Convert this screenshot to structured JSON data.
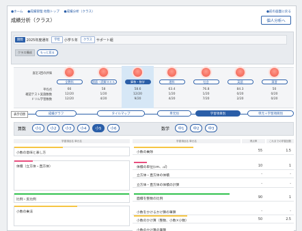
{
  "breadcrumb": [
    "●ホーム",
    "●成績管理 他塾トップ",
    "●成績分析（クラス）"
  ],
  "top_link": "●前の画面に戻る",
  "page_title": "成績分析（クラス）",
  "personal_button": "個人分析へ",
  "filters": {
    "period_tag": "期間",
    "period_value": "2025年度通年",
    "grade_tag": "学年",
    "grade_value": "小学５年",
    "class_tag": "クラス",
    "class_value": "サポート組",
    "class_members_chip": "クラス構成",
    "more_chip": "もっと見る"
  },
  "row_labels": {
    "eval": "直近3回の評価",
    "avg": "平均点",
    "test_count": "確認テスト実施数数",
    "drill_count": "ドリル学習数数"
  },
  "subjects": [
    {
      "name": "全教科",
      "avg": "66",
      "test": "12/20",
      "drill": "12/20"
    },
    {
      "name": "国語・読解スキル",
      "avg": "58",
      "test": "1/20",
      "drill": "4/20"
    },
    {
      "name": "算数・数学",
      "avg": "58.6",
      "test": "12/20",
      "drill": "9/20",
      "selected": true
    },
    {
      "name": "理科",
      "avg": "63.4",
      "test": "1/20",
      "drill": "4/20"
    },
    {
      "name": "社会",
      "avg": "76.8",
      "test": "1/20",
      "drill": "7/20"
    },
    {
      "name": "英語",
      "avg": "84.3",
      "test": "0/20",
      "drill": "2/20"
    },
    {
      "name": "演習",
      "avg": "50",
      "test": "0/20",
      "drill": "0/20"
    }
  ],
  "view_switch": {
    "label": "表示切替",
    "tabs": [
      "成績グラフ",
      "タイルマップ",
      "単元別",
      "学習項目別",
      "単元＋学習項目別"
    ],
    "active_index": 3
  },
  "units": {
    "left_label": "算数",
    "left_items": [
      "小1",
      "小2",
      "小3",
      "小4",
      "小5",
      "小6"
    ],
    "left_active": 4,
    "right_label": "数学",
    "right_items": [
      "中1",
      "中2",
      "中3"
    ]
  },
  "columns": {
    "left_header": "学習項目名 単元名",
    "right_header": "学習項目名 単元名",
    "score_header": "得点率",
    "rank_header": "これまでの学習回数"
  },
  "left_items": [
    {
      "label": "小数の意味と表し方",
      "color": "#f5c542",
      "pct": 0.42
    },
    {
      "label": "体積（立方体・直方体）",
      "color": "#e84d7d",
      "pct": 0.16
    },
    {
      "label": "比例・反比例",
      "color": "#30c14d",
      "pct": 1.0
    },
    {
      "label": "小数の乗法",
      "color": "#f5c542",
      "pct": 0.55
    }
  ],
  "right_items": [
    {
      "label": "小数の乗除",
      "color": "#f5c542",
      "pct": 0.56,
      "score": "55",
      "count": "1.5"
    },
    {
      "label": "体積の単位(cm、㎥)",
      "color": "#e84d7d",
      "pct": 0.12,
      "score": "10",
      "count": "1"
    },
    {
      "label": "立方体・直方体の体積",
      "color": "",
      "pct": 0,
      "score": "-",
      "count": "-"
    },
    {
      "label": "立方体・直方体の体積の計算",
      "color": "",
      "pct": 0,
      "score": "-",
      "count": "-"
    },
    {
      "label": "面積を整数の比例",
      "color": "#30c14d",
      "pct": 0.9,
      "score": "90",
      "count": "1"
    },
    {
      "label": "小数をかけるかけ算の筆算",
      "color": "",
      "pct": 0,
      "score": "-",
      "count": "-"
    },
    {
      "label": "小数のかけ算（整数、小数×小数）",
      "color": "#f5c542",
      "pct": 0.5,
      "score": "50",
      "count": "2.5"
    },
    {
      "label": "小数のかけ算の筆算",
      "color": "",
      "pct": 0,
      "score": "",
      "count": ""
    }
  ]
}
